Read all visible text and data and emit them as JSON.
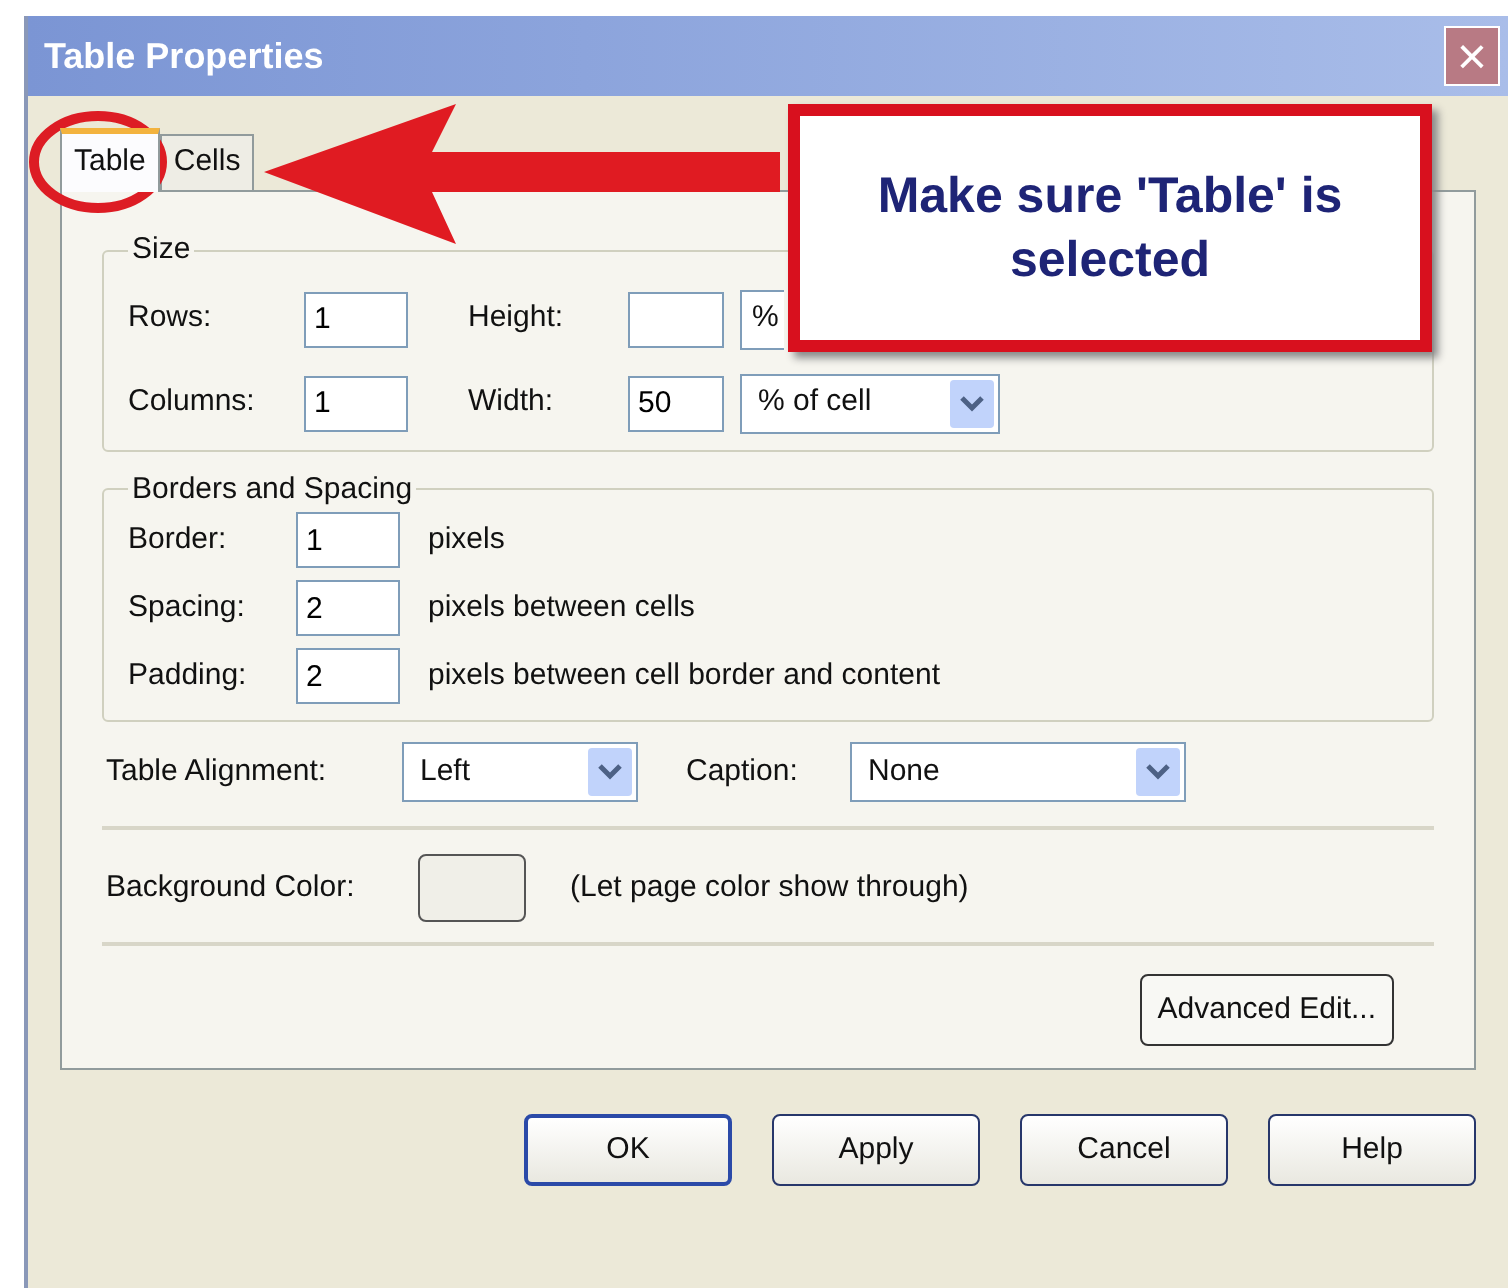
{
  "window": {
    "title": "Table Properties",
    "close": "×"
  },
  "tabs": [
    {
      "label": "Table",
      "selected": true
    },
    {
      "label": "Cells",
      "selected": false
    }
  ],
  "size": {
    "legend": "Size",
    "rows": {
      "label": "Rows:",
      "value": "1"
    },
    "height": {
      "label": "Height:",
      "unit": "%"
    },
    "columns": {
      "label": "Columns:",
      "value": "1"
    },
    "width": {
      "label": "Width:",
      "value": "50",
      "unit": "% of cell"
    }
  },
  "borders": {
    "legend": "Borders and Spacing",
    "rows": [
      {
        "label": "Border:",
        "value": "1",
        "hint": "pixels"
      },
      {
        "label": "Spacing:",
        "value": "2",
        "hint": "pixels between cells"
      },
      {
        "label": "Padding:",
        "value": "2",
        "hint": "pixels between cell border and content"
      }
    ]
  },
  "alignment": {
    "label": "Table Alignment:",
    "value": "Left"
  },
  "caption": {
    "label": "Caption:",
    "value": "None"
  },
  "background": {
    "label": "Background Color:",
    "note": "(Let page color show through)"
  },
  "advanced_button": "Advanced Edit...",
  "buttons": [
    {
      "label": "OK",
      "default": true
    },
    {
      "label": "Apply",
      "default": false
    },
    {
      "label": "Cancel",
      "default": false
    },
    {
      "label": "Help",
      "default": false
    }
  ],
  "callout": {
    "text": "Make sure 'Table' is selected"
  }
}
